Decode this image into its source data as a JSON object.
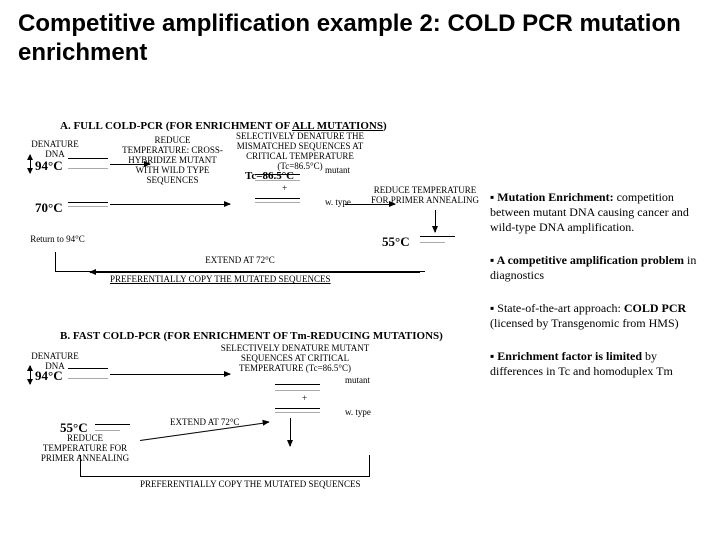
{
  "title": "Competitive amplification example 2: COLD PCR mutation enrichment",
  "sectionA": {
    "title_prefix": "A. FULL",
    "title_bold": "COLD-PCR",
    "title_suffix": "(FOR ENRICHMENT OF",
    "title_underline": "ALL MUTATIONS",
    "title_close": ")",
    "denature": "DENATURE DNA",
    "temp1": "94°C",
    "crosshyb": "REDUCE TEMPERATURE: CROSS-HYBRIDIZE MUTANT WITH WILD TYPE SEQUENCES",
    "temp2": "70°C",
    "selective": "SELECTIVELY DENATURE THE MISMATCHED SEQUENCES AT CRITICAL TEMPERATURE (Tc=86.5°C)",
    "tc": "Tc=86.5°C",
    "mutant": "mutant",
    "wtype": "w. type",
    "anneal": "REDUCE TEMPERATURE FOR PRIMER ANNEALING",
    "temp3": "55°C",
    "extend": "EXTEND AT 72°C",
    "return": "Return to 94°C",
    "pref": "PREFERENTIALLY COPY THE MUTATED SEQUENCES"
  },
  "sectionB": {
    "title_prefix": "B. FAST",
    "title_bold": "COLD-PCR",
    "title_suffix": "(FOR ENRICHMENT OF Tm-REDUCING MUTATIONS)",
    "denature": "DENATURE DNA",
    "temp1": "94°C",
    "selective": "SELECTIVELY DENATURE MUTANT SEQUENCES AT CRITICAL TEMPERATURE (Tc=86.5°C)",
    "mutant": "mutant",
    "wtype": "w. type",
    "temp2": "55°C",
    "anneal": "REDUCE TEMPERATURE FOR PRIMER ANNEALING",
    "extend": "EXTEND AT 72°C",
    "pref": "PREFERENTIALLY COPY THE MUTATED SEQUENCES"
  },
  "bullets": {
    "b1_lead": "Mutation Enrichment:",
    "b1_rest": " competition between mutant DNA causing cancer and wild-type DNA amplification.",
    "b2_lead": "A competitive amplification problem",
    "b2_rest": " in diagnostics",
    "b3_lead": "State-of-the-art approach:",
    "b3_bold": "COLD PCR",
    "b3_rest": " (licensed by Transgenomic from HMS)",
    "b4_lead": "Enrichment factor is limited",
    "b4_rest": " by differences in Tc and homoduplex Tm"
  }
}
